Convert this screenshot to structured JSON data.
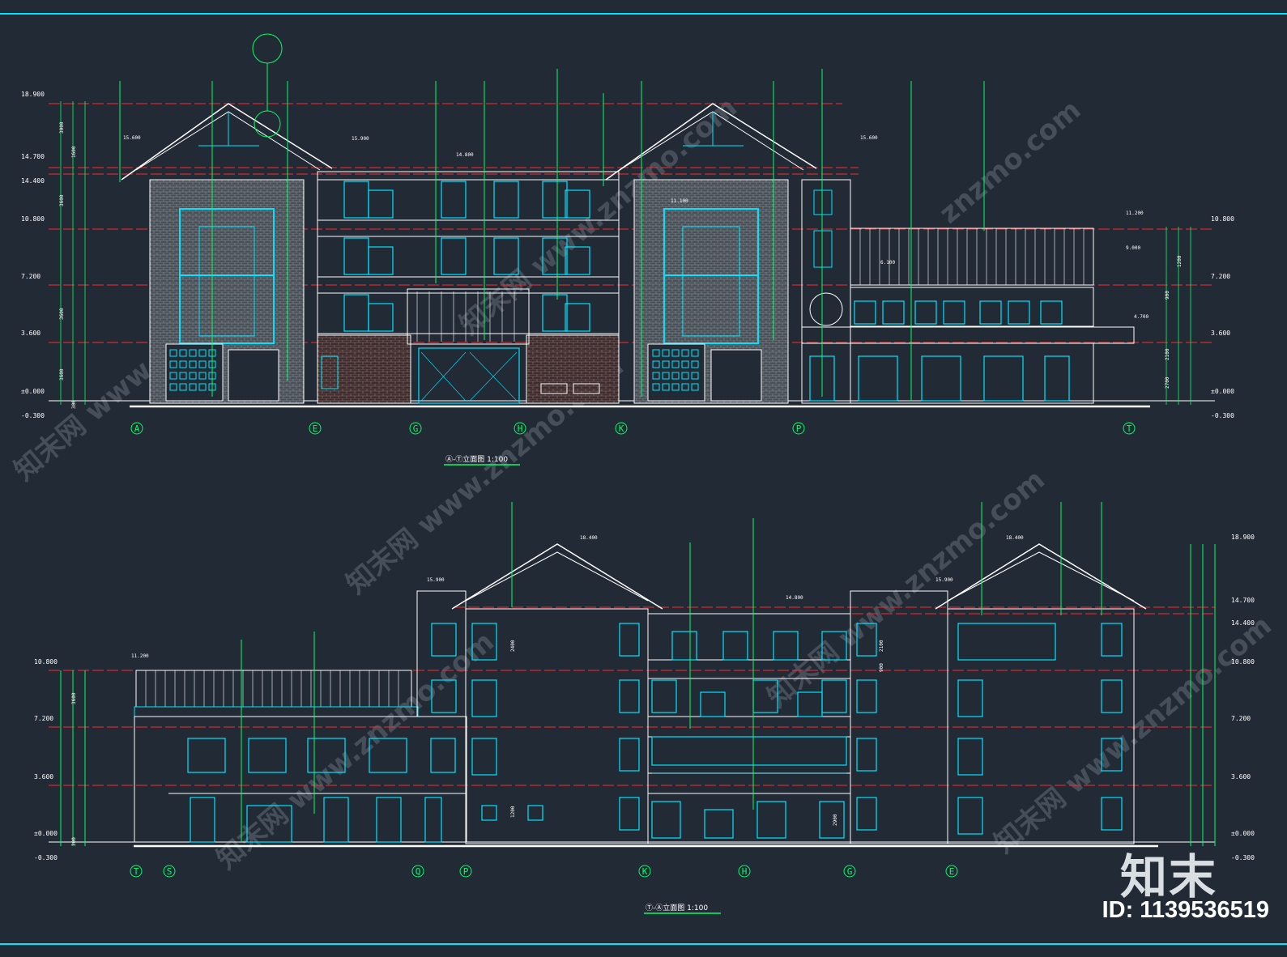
{
  "top_drawing": {
    "title": "Ⓐ-Ⓣ立面图 1:100",
    "axes": [
      "A",
      "E",
      "G",
      "H",
      "K",
      "P",
      "T"
    ],
    "left_levels": [
      "18.900",
      "14.700",
      "14.400",
      "10.800",
      "7.200",
      "3.600",
      "±0.000",
      "-0.300"
    ],
    "right_levels": [
      "10.800",
      "7.200",
      "3.600",
      "±0.000",
      "-0.300"
    ],
    "tags": [
      "15.600",
      "15.900",
      "14.800",
      "15.600",
      "11.200",
      "9.000",
      "4.700",
      "6.100",
      "11.100"
    ],
    "dims": [
      "3000",
      "1600",
      "3600",
      "3600",
      "3600",
      "300",
      "900",
      "2100",
      "2700",
      "1200"
    ]
  },
  "bottom_drawing": {
    "title": "Ⓣ-Ⓐ立面图 1:100",
    "axes": [
      "T",
      "S",
      "Q",
      "P",
      "K",
      "H",
      "G",
      "E"
    ],
    "left_levels": [
      "10.800",
      "7.200",
      "3.600",
      "±0.000",
      "-0.300"
    ],
    "right_levels": [
      "18.900",
      "14.700",
      "14.400",
      "10.800",
      "7.200",
      "3.600",
      "±0.000",
      "-0.300"
    ],
    "tags": [
      "18.400",
      "18.400",
      "15.900",
      "15.900",
      "14.800",
      "11.200"
    ],
    "dims": [
      "3600",
      "2400",
      "2100",
      "900",
      "1200",
      "300",
      "2900"
    ]
  },
  "brand": {
    "name": "知末",
    "id": "ID: 1139536519"
  },
  "watermarks": [
    "知末网 www.znzmo.com",
    "知末网 www.znzmo.com",
    "知末网 www.znzmo.com",
    "znzmo.com",
    "知末网 www.znzmo.com",
    "知末网 www.znzmo.com",
    "知末网 www.znzmo.com"
  ],
  "colors": {
    "bg": "#222a35",
    "line": "#ffffff",
    "cyan": "#00e5ff",
    "green": "#00ff66",
    "red": "#ff2a2a",
    "brick": "#8a8f96"
  }
}
